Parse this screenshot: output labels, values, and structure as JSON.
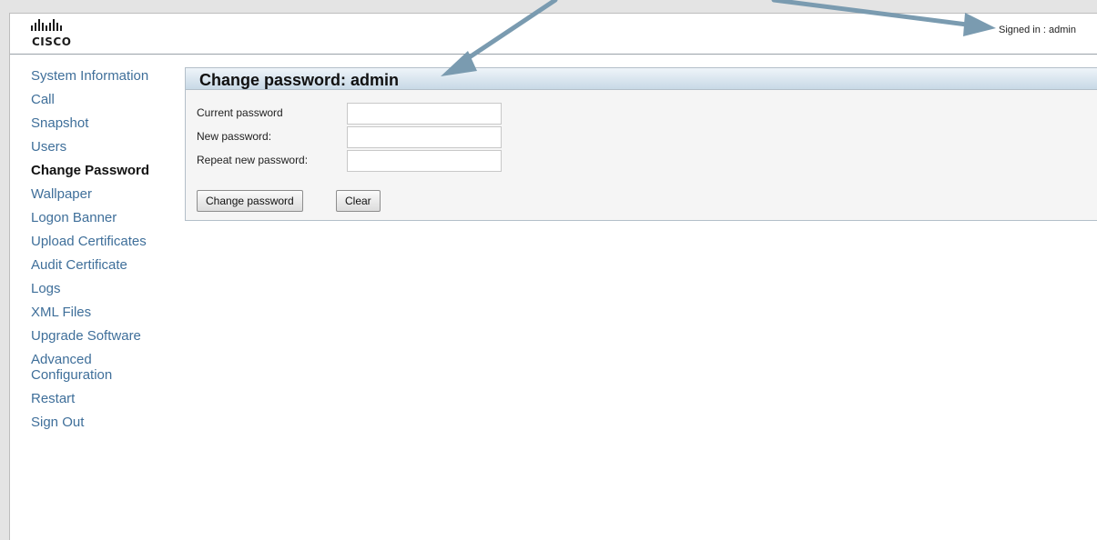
{
  "header": {
    "logo_text": "CISCO",
    "signed_in_label": "Signed in :",
    "signed_in_user": "admin"
  },
  "sidebar": {
    "items": [
      {
        "label": "System Information"
      },
      {
        "label": "Call"
      },
      {
        "label": "Snapshot"
      },
      {
        "label": "Users"
      },
      {
        "label": "Change Password",
        "active": true
      },
      {
        "label": "Wallpaper"
      },
      {
        "label": "Logon Banner"
      },
      {
        "label": "Upload Certificates"
      },
      {
        "label": "Audit Certificate"
      },
      {
        "label": "Logs"
      },
      {
        "label": "XML Files"
      },
      {
        "label": "Upgrade Software"
      },
      {
        "label": "Advanced Configuration"
      },
      {
        "label": "Restart"
      },
      {
        "label": "Sign Out"
      }
    ]
  },
  "panel": {
    "title": "Change password: admin",
    "fields": [
      {
        "label": "Current password",
        "value": ""
      },
      {
        "label": "New password:",
        "value": ""
      },
      {
        "label": "Repeat new password:",
        "value": ""
      }
    ],
    "buttons": {
      "submit_label": "Change password",
      "clear_label": "Clear"
    }
  },
  "colors": {
    "nav_link": "#3f6f9a",
    "panel_header": "#c8d9e6",
    "annotation_arrow": "#7a9bb0"
  },
  "icons": [
    "cisco-logo",
    "annotation-arrow"
  ]
}
